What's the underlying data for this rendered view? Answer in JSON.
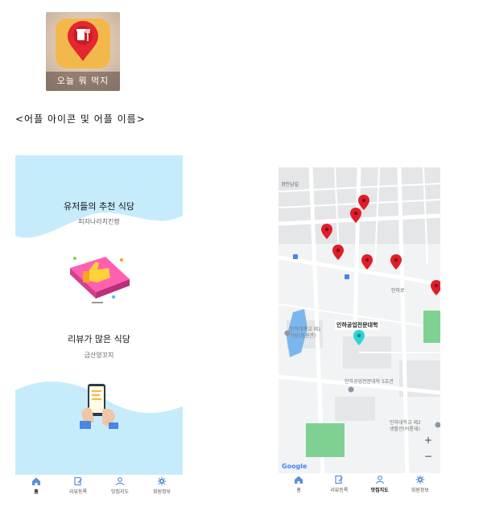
{
  "app_icon": {
    "label": "오늘 뭐 먹지"
  },
  "caption": "<어플 아이콘 및 어플 이름>",
  "screen_home": {
    "section1": {
      "title": "유저들의 추천 식당",
      "subtitle": "피자나라치킨짱"
    },
    "section2": {
      "title": "리뷰가 많은 식당",
      "subtitle": "금산양꼬치"
    }
  },
  "screen_map": {
    "labels": {
      "road1": "인하로",
      "road2": "경인남길",
      "highlight": "인하공업전문대학",
      "poi1_line1": "인하대학교 제1",
      "poi1_line2": "식당(동원관)",
      "poi2": "인하공업전문대학 5호관",
      "poi3_line1": "인하대학교 제2",
      "poi3_line2": "생활관(비룡재)",
      "google": "Google"
    },
    "zoom": {
      "plus": "+",
      "minus": "−"
    }
  },
  "nav_home": {
    "items": [
      {
        "label": "홈",
        "icon": "home-icon"
      },
      {
        "label": "리뷰등록",
        "icon": "edit-icon"
      },
      {
        "label": "맛집지도",
        "icon": "user-icon"
      },
      {
        "label": "회원정보",
        "icon": "gear-icon"
      }
    ],
    "active": 0
  },
  "nav_map": {
    "items": [
      {
        "label": "홈",
        "icon": "home-icon"
      },
      {
        "label": "리뷰등록",
        "icon": "edit-icon"
      },
      {
        "label": "맛집지도",
        "icon": "user-icon"
      },
      {
        "label": "회원정보",
        "icon": "gear-icon"
      }
    ],
    "active": 2
  },
  "colors": {
    "accent_blue": "#5a8fd8",
    "wave": "#c6ecfb",
    "pin_red": "#e11d2a",
    "pin_cyan": "#2ed3d3"
  }
}
